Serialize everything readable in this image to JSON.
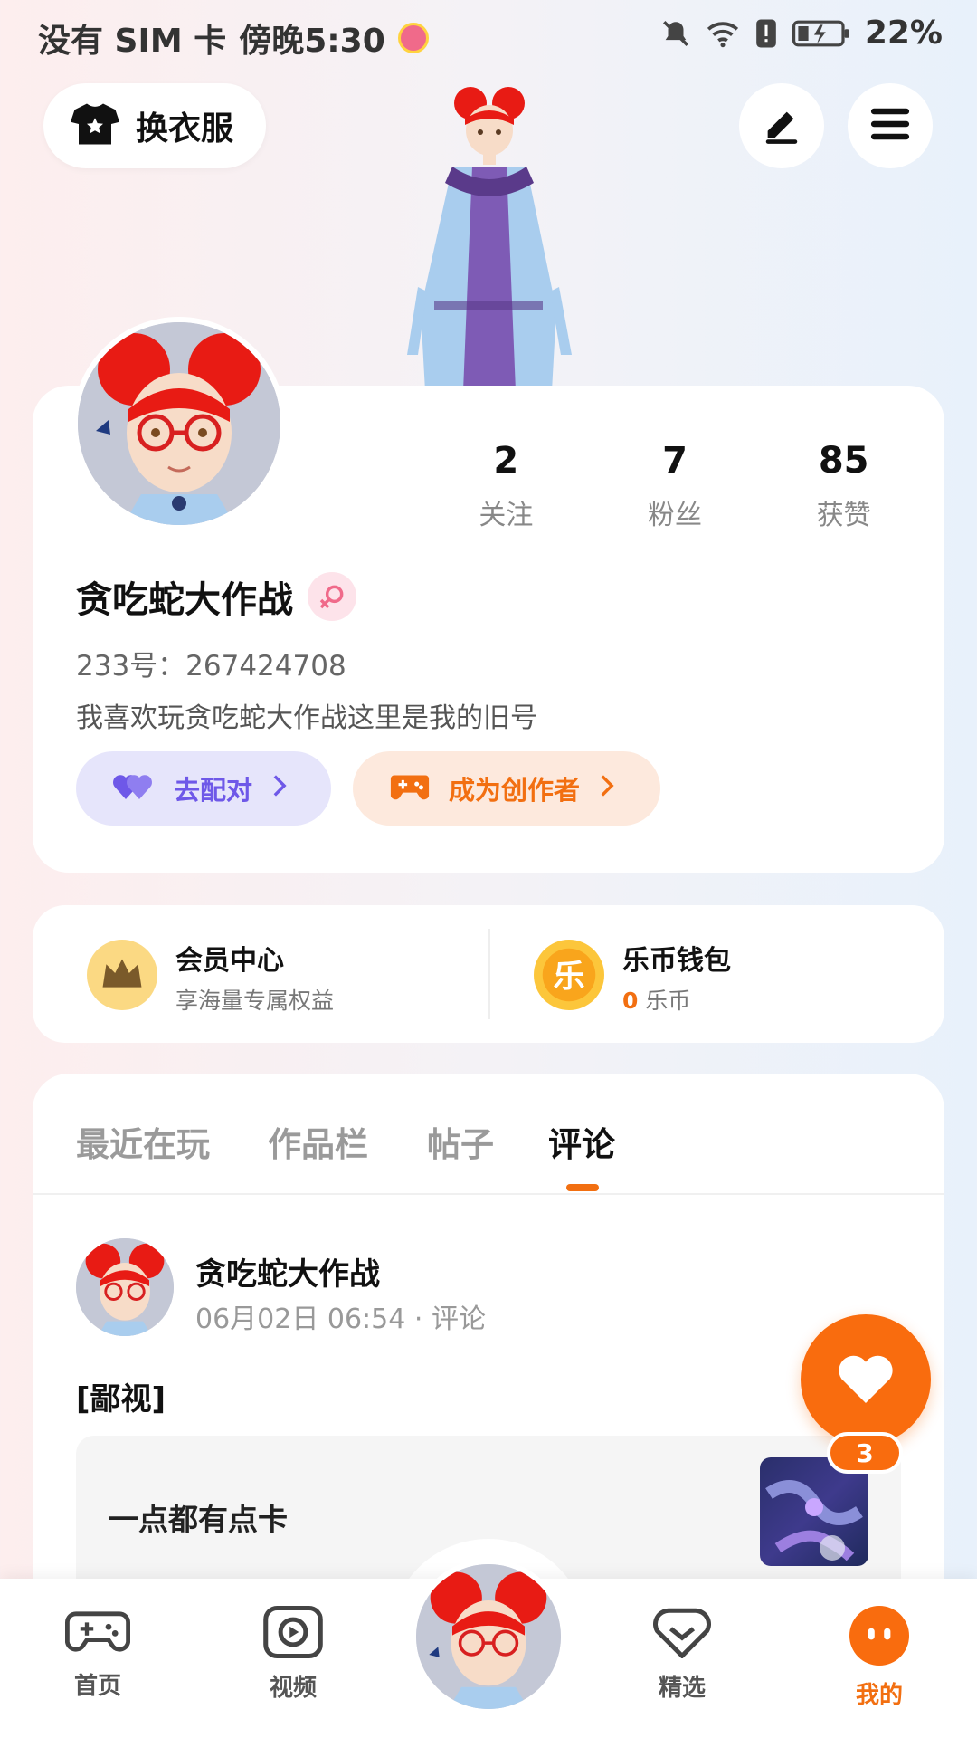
{
  "status_bar": {
    "carrier": "没有 SIM 卡",
    "time": "傍晚5:30",
    "battery": "22%"
  },
  "header": {
    "outfit_label": "换衣服",
    "edit_icon": "pencil-icon",
    "menu_icon": "menu-icon"
  },
  "profile": {
    "stats": [
      {
        "value": "2",
        "label": "关注"
      },
      {
        "value": "7",
        "label": "粉丝"
      },
      {
        "value": "85",
        "label": "获赞"
      }
    ],
    "username": "贪吃蛇大作战",
    "gender_icon": "female-symbol-icon",
    "user_id": "233号：267424708",
    "bio": "我喜欢玩贪吃蛇大作战这里是我的旧号",
    "match_label": "去配对",
    "creator_label": "成为创作者"
  },
  "vip": {
    "member_title": "会员中心",
    "member_sub": "享海量专属权益",
    "wallet_title": "乐币钱包",
    "wallet_count": "0",
    "wallet_unit": "乐币",
    "wallet_icon_char": "乐"
  },
  "tabs": [
    "最近在玩",
    "作品栏",
    "帖子",
    "评论"
  ],
  "active_tab": "评论",
  "post": {
    "author": "贪吃蛇大作战",
    "meta": "06月02日 06:54 · 评论",
    "text": "[鄙视]",
    "quote": "一点都有点卡"
  },
  "fab": {
    "icon": "heart-icon",
    "badge": "3"
  },
  "bottom_nav": [
    {
      "label": "首页",
      "icon": "gamepad-icon"
    },
    {
      "label": "视频",
      "icon": "play-icon"
    },
    {
      "label": "精选",
      "icon": "heart-outline-icon"
    },
    {
      "label": "我的",
      "icon": "face-icon"
    }
  ],
  "colors": {
    "accent": "#f26f11",
    "match": "#6e58e8"
  }
}
